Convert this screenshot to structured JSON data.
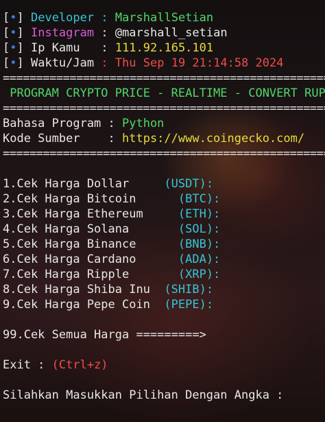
{
  "header": {
    "rows": [
      {
        "bracket_l": "[",
        "dot": "•",
        "bracket_r": "]",
        "label": " Developer ",
        "colon": ": ",
        "value": "MarshallSetian",
        "label_color": "cyan",
        "value_color": "green"
      },
      {
        "bracket_l": "[",
        "dot": "•",
        "bracket_r": "]",
        "label": " Instagram ",
        "colon": ": ",
        "value": "@marshall_setian",
        "label_color": "magenta",
        "value_color": "white"
      },
      {
        "bracket_l": "[",
        "dot": "•",
        "bracket_r": "]",
        "label": " Ip Kamu   ",
        "colon": ": ",
        "value": "111.92.165.101",
        "label_color": "white",
        "value_color": "yellow"
      },
      {
        "bracket_l": "[",
        "dot": "•",
        "bracket_r": "]",
        "label": " Waktu/Jam ",
        "colon": ": ",
        "value": "Thu Sep 19 21:14:58 2024",
        "label_color": "white",
        "value_color": "red"
      }
    ]
  },
  "separator": "=================================================================",
  "banner": " PROGRAM CRYPTO PRICE - REALTIME - CONVERT RUPIAH",
  "info": {
    "language_label": "Bahasa Program : ",
    "language_value": "Python",
    "source_label": "Kode Sumber    : ",
    "source_value": "https://www.coingecko.com/"
  },
  "menu": [
    {
      "label": "1.Cek Harga Dollar     ",
      "ticker": "(USDT):"
    },
    {
      "label": "2.Cek Harga Bitcoin      ",
      "ticker": "(BTC):"
    },
    {
      "label": "3.Cek Harga Ethereum     ",
      "ticker": "(ETH):"
    },
    {
      "label": "4.Cek Harga Solana       ",
      "ticker": "(SOL):"
    },
    {
      "label": "5.Cek Harga Binance      ",
      "ticker": "(BNB):"
    },
    {
      "label": "6.Cek Harga Cardano      ",
      "ticker": "(ADA):"
    },
    {
      "label": "7.Cek Harga Ripple       ",
      "ticker": "(XRP):"
    },
    {
      "label": "8.Cek Harga Shiba Inu  ",
      "ticker": "(SHIB):"
    },
    {
      "label": "9.Cek Harga Pepe Coin  ",
      "ticker": "(PEPE):"
    }
  ],
  "all_option": "99.Cek Semua Harga =========>",
  "exit": {
    "label": "Exit : ",
    "shortcut": "(Ctrl+z)"
  },
  "prompt": "Silahkan Masukkan Pilihan Dengan Angka : ",
  "colors": {
    "cyan": "#34c6d8",
    "green": "#4fd86a",
    "magenta": "#d45fd4",
    "yellow": "#e8dc3a",
    "red": "#ef4c4c",
    "blue": "#3a7fe0",
    "white": "#e8e8e8"
  }
}
